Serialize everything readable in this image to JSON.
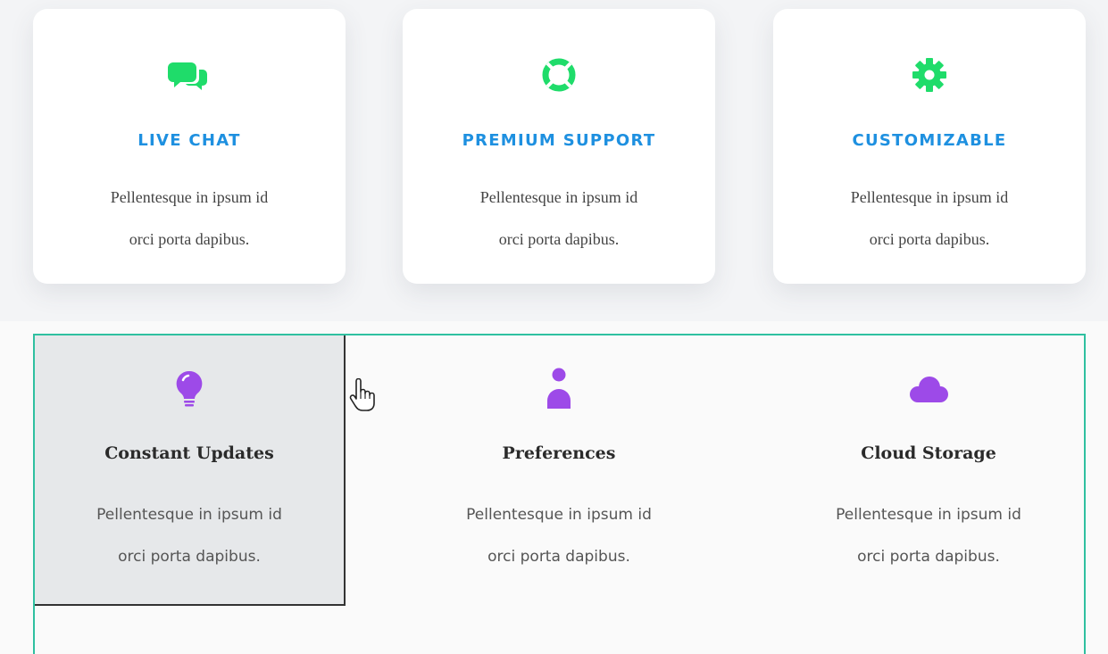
{
  "colors": {
    "card_title": "#1e90e0",
    "card_icon": "#1fdc6a",
    "feature_icon": "#9d4ae8",
    "frame_border": "#2fc0a0",
    "selected_bg": "#e6e8ea"
  },
  "cards": [
    {
      "icon": "chat-bubbles-icon",
      "title": "LIVE CHAT",
      "line1": "Pellentesque in ipsum id",
      "line2": "orci porta dapibus."
    },
    {
      "icon": "lifebuoy-icon",
      "title": "PREMIUM SUPPORT",
      "line1": "Pellentesque in ipsum id",
      "line2": "orci porta dapibus."
    },
    {
      "icon": "gear-icon",
      "title": "CUSTOMIZABLE",
      "line1": "Pellentesque in ipsum id",
      "line2": "orci porta dapibus."
    }
  ],
  "features": [
    {
      "icon": "lightbulb-icon",
      "title": "Constant Updates",
      "line1": "Pellentesque in ipsum id",
      "line2": "orci porta dapibus.",
      "selected": true
    },
    {
      "icon": "user-icon",
      "title": "Preferences",
      "line1": "Pellentesque in ipsum id",
      "line2": "orci porta dapibus.",
      "selected": false
    },
    {
      "icon": "cloud-icon",
      "title": "Cloud Storage",
      "line1": "Pellentesque in ipsum id",
      "line2": "orci porta dapibus.",
      "selected": false
    }
  ],
  "cursor": "hand-pointer-icon"
}
